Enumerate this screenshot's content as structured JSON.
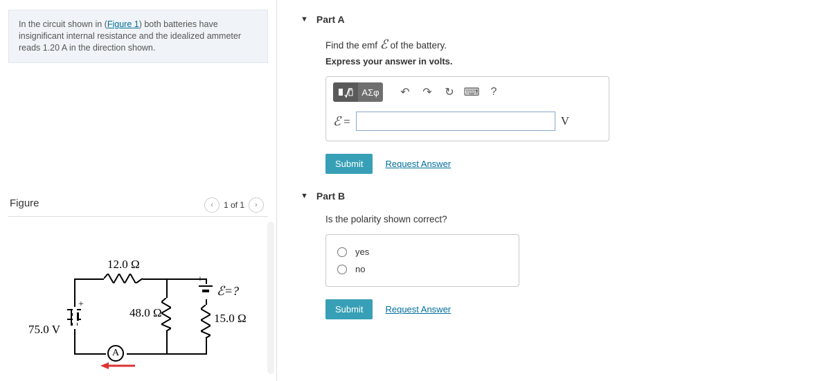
{
  "problem": {
    "text_pre": "In the circuit shown in (",
    "link": "Figure 1",
    "text_post": ") both batteries have insignificant internal resistance and the idealized ammeter reads 1.20 A in the direction shown."
  },
  "figure": {
    "heading": "Figure",
    "counter": "1 of 1",
    "labels": {
      "r_top": "12.0 Ω",
      "r_mid": "48.0 Ω",
      "r_right": "15.0 Ω",
      "v_left": "75.0 V",
      "emf": "ℰ=?",
      "ammeter": "A",
      "plus1": "+",
      "plus2": "+"
    }
  },
  "partA": {
    "title": "Part A",
    "instr": "Find the emf ℰ of the battery.",
    "instr2": "Express your answer in volts.",
    "toolbar": {
      "templates": "ΑΣφ",
      "undo": "↶",
      "redo": "↷",
      "reset": "↻",
      "keyboard": "⌨",
      "help": "?"
    },
    "var": "ℰ =",
    "unit": "V",
    "submit": "Submit",
    "request": "Request Answer"
  },
  "partB": {
    "title": "Part B",
    "instr": "Is the polarity shown correct?",
    "opt_yes": "yes",
    "opt_no": "no",
    "submit": "Submit",
    "request": "Request Answer"
  }
}
